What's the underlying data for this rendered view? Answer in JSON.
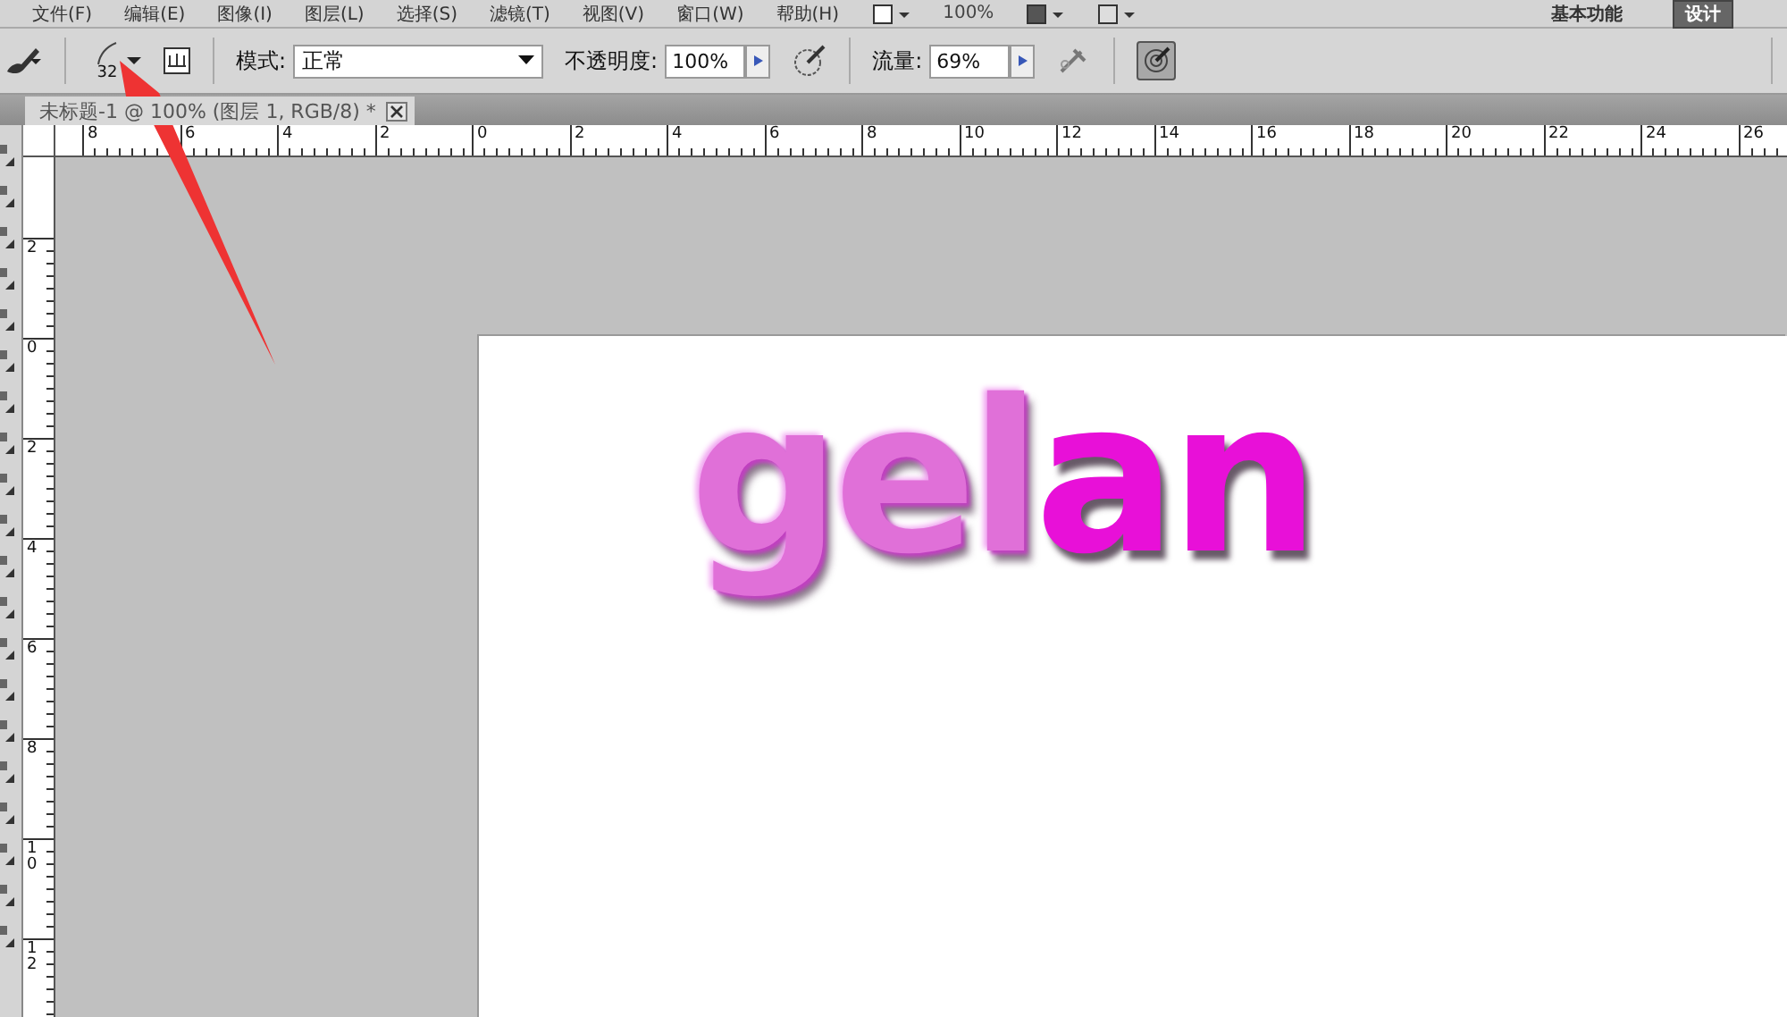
{
  "menu_bar": {
    "items": [
      "文件(F)",
      "编辑(E)",
      "图像(I)",
      "图层(L)",
      "选择(S)",
      "滤镜(T)",
      "视图(V)",
      "窗口(W)",
      "帮助(H)"
    ],
    "zoom": "100%",
    "workspaces": [
      {
        "label": "基本功能",
        "selected": false
      },
      {
        "label": "设计",
        "selected": true
      }
    ]
  },
  "options_bar": {
    "brush_size": "32",
    "mode_label": "模式:",
    "mode_value": "正常",
    "opacity_label": "不透明度:",
    "opacity_value": "100%",
    "flow_label": "流量:",
    "flow_value": "69%",
    "tablet_pressure_on": true
  },
  "document_tab": {
    "title": "未标题-1 @ 100% (图层 1, RGB/8) *"
  },
  "rulers": {
    "horizontal": [
      "8",
      "6",
      "4",
      "2",
      "0",
      "2",
      "4",
      "6",
      "8",
      "10",
      "12",
      "14",
      "16",
      "18",
      "20",
      "22",
      "24",
      "26"
    ],
    "vertical": [
      "2",
      "0",
      "2",
      "4",
      "6",
      "8",
      "10",
      "12"
    ]
  },
  "canvas": {
    "fur_text": "gel",
    "plain_text": "an"
  }
}
